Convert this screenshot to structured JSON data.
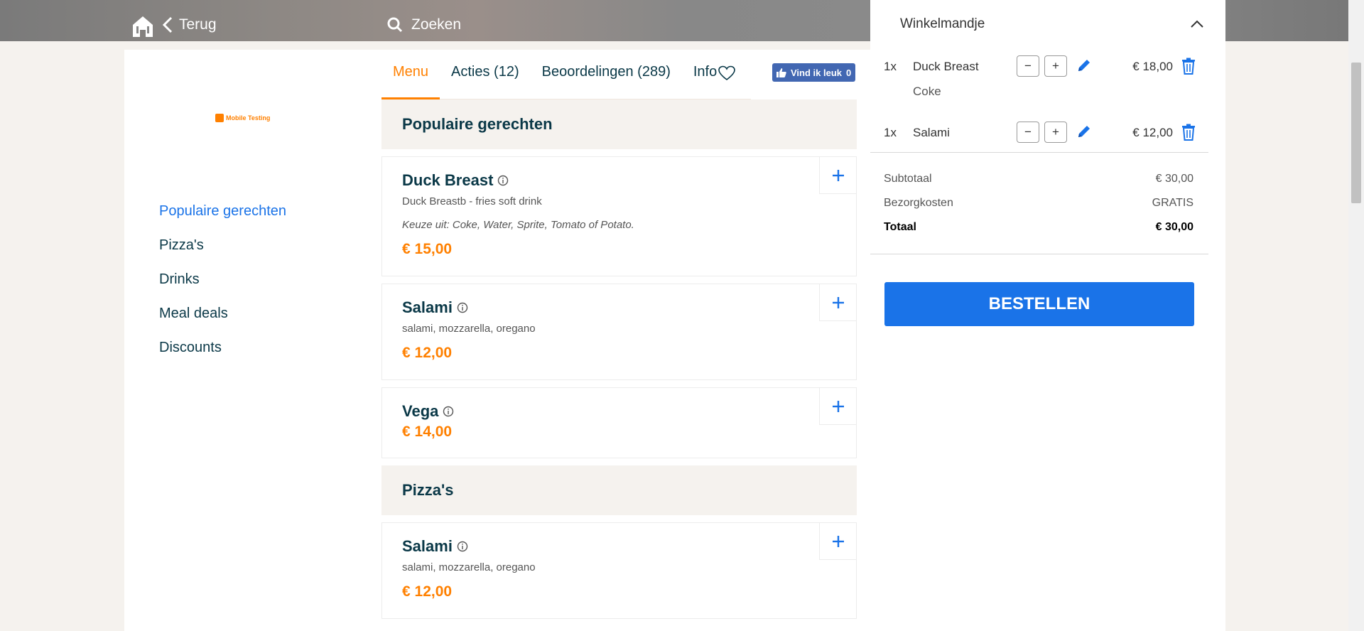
{
  "header": {
    "back_label": "Terug",
    "search_label": "Zoeken"
  },
  "restaurant": {
    "logo_text": "Mobile Testing"
  },
  "categories": [
    {
      "label": "Populaire gerechten",
      "active": true
    },
    {
      "label": "Pizza's",
      "active": false
    },
    {
      "label": "Drinks",
      "active": false
    },
    {
      "label": "Meal deals",
      "active": false
    },
    {
      "label": "Discounts",
      "active": false
    }
  ],
  "tabs": {
    "menu": "Menu",
    "acties": "Acties (12)",
    "reviews": "Beoordelingen (289)",
    "info": "Info"
  },
  "fb_like": {
    "label": "Vind ik leuk",
    "count": "0"
  },
  "menu": {
    "section1": "Populaire gerechten",
    "section2": "Pizza's",
    "items": [
      {
        "name": "Duck Breast",
        "desc": "Duck Breastb - fries soft drink",
        "choice": "Keuze uit: Coke, Water, Sprite, Tomato of Potato.",
        "price": "€ 15,00"
      },
      {
        "name": "Salami",
        "desc": "salami, mozzarella, oregano",
        "price": "€ 12,00"
      },
      {
        "name": "Vega",
        "price": "€ 14,00"
      },
      {
        "name": "Salami",
        "desc": "salami, mozzarella, oregano",
        "price": "€ 12,00"
      }
    ]
  },
  "cart": {
    "title": "Winkelmandje",
    "lines": [
      {
        "qty": "1x",
        "name": "Duck Breast",
        "sub": "Coke",
        "price": "€ 18,00"
      },
      {
        "qty": "1x",
        "name": "Salami",
        "price": "€ 12,00"
      }
    ],
    "minus": "−",
    "plus": "+",
    "subtotal_label": "Subtotaal",
    "subtotal": "€ 30,00",
    "delivery_label": "Bezorgkosten",
    "delivery": "GRATIS",
    "total_label": "Totaal",
    "total": "€ 30,00",
    "order_label": "BESTELLEN"
  },
  "colors": {
    "accent_orange": "#ff8000",
    "accent_blue": "#1a73e8",
    "text_dark": "#0a3847",
    "page_bg": "#f5f2ee"
  }
}
